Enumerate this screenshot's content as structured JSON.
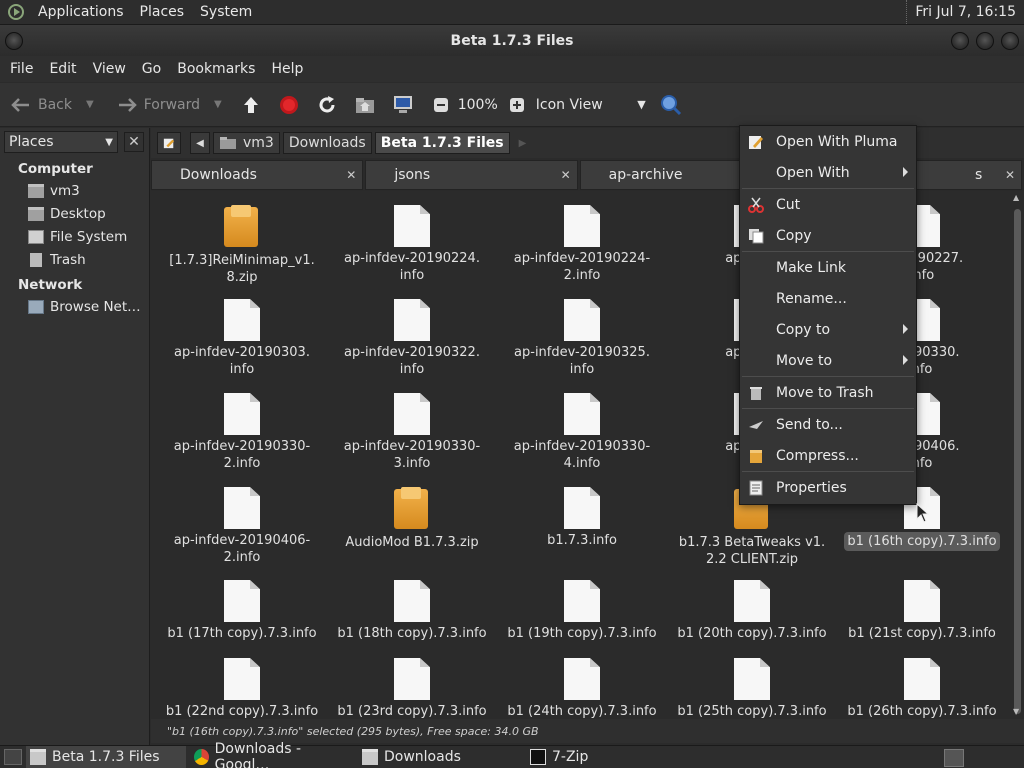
{
  "top_panel": {
    "menus": [
      "Applications",
      "Places",
      "System"
    ],
    "clock": "Fri Jul  7, 16:15"
  },
  "window": {
    "title": "Beta 1.7.3 Files"
  },
  "menubar": [
    "File",
    "Edit",
    "View",
    "Go",
    "Bookmarks",
    "Help"
  ],
  "toolbar": {
    "back": "Back",
    "forward": "Forward",
    "zoom": "100%",
    "view_mode": "Icon View"
  },
  "sidebar": {
    "selector": "Places",
    "groups": [
      {
        "label": "Computer",
        "items": [
          "vm3",
          "Desktop",
          "File System",
          "Trash"
        ]
      },
      {
        "label": "Network",
        "items": [
          "Browse Net…"
        ]
      }
    ]
  },
  "pathbar": {
    "crumbs": [
      "vm3",
      "Downloads",
      "Beta 1.7.3 Files"
    ]
  },
  "tabs": [
    "Downloads",
    "jsons",
    "ap-archive",
    "s"
  ],
  "files": [
    {
      "name": "[1.7.3]ReiMinimap_v1.\n8.zip",
      "type": "zip"
    },
    {
      "name": "ap-infdev-20190224.\ninfo",
      "type": "doc"
    },
    {
      "name": "ap-infdev-20190224-\n2.info",
      "type": "doc"
    },
    {
      "name": "ap-infde",
      "type": "doc"
    },
    {
      "name": "v-20190227.\ninfo",
      "type": "doc"
    },
    {
      "name": "ap-infdev-20190303.\ninfo",
      "type": "doc"
    },
    {
      "name": "ap-infdev-20190322.\ninfo",
      "type": "doc"
    },
    {
      "name": "ap-infdev-20190325.\ninfo",
      "type": "doc"
    },
    {
      "name": "ap-infde",
      "type": "doc"
    },
    {
      "name": "-20190330.\nnfo",
      "type": "doc"
    },
    {
      "name": "ap-infdev-20190330-\n2.info",
      "type": "doc"
    },
    {
      "name": "ap-infdev-20190330-\n3.info",
      "type": "doc"
    },
    {
      "name": "ap-infdev-20190330-\n4.info",
      "type": "doc"
    },
    {
      "name": "ap-infde",
      "type": "doc"
    },
    {
      "name": "-20190406.\nnfo",
      "type": "doc"
    },
    {
      "name": "ap-infdev-20190406-\n2.info",
      "type": "doc"
    },
    {
      "name": "AudioMod B1.7.3.zip",
      "type": "zip"
    },
    {
      "name": "b1.7.3.info",
      "type": "doc"
    },
    {
      "name": "b1.7.3 BetaTweaks v1.\n2.2 CLIENT.zip",
      "type": "zip"
    },
    {
      "name": "b1 (16th copy).7.3.info",
      "type": "doc",
      "selected": true
    },
    {
      "name": "b1 (17th copy).7.3.info",
      "type": "doc"
    },
    {
      "name": "b1 (18th copy).7.3.info",
      "type": "doc"
    },
    {
      "name": "b1 (19th copy).7.3.info",
      "type": "doc"
    },
    {
      "name": "b1 (20th copy).7.3.info",
      "type": "doc"
    },
    {
      "name": "b1 (21st copy).7.3.info",
      "type": "doc"
    },
    {
      "name": "b1 (22nd copy).7.3.info",
      "type": "doc"
    },
    {
      "name": "b1 (23rd copy).7.3.info",
      "type": "doc"
    },
    {
      "name": "b1 (24th copy).7.3.info",
      "type": "doc"
    },
    {
      "name": "b1 (25th copy).7.3.info",
      "type": "doc"
    },
    {
      "name": "b1 (26th copy).7.3.info",
      "type": "doc"
    }
  ],
  "status": "\"b1 (16th copy).7.3.info\" selected (295 bytes), Free space: 34.0 GB",
  "context_menu": [
    {
      "label": "Open With Pluma",
      "icon": "pluma-icon"
    },
    {
      "label": "Open With",
      "submenu": true
    },
    {
      "sep": true
    },
    {
      "label": "Cut",
      "icon": "scissors-icon"
    },
    {
      "label": "Copy",
      "icon": "copy-icon"
    },
    {
      "sep": true
    },
    {
      "label": "Make Link"
    },
    {
      "label": "Rename..."
    },
    {
      "label": "Copy to",
      "submenu": true
    },
    {
      "label": "Move to",
      "submenu": true
    },
    {
      "sep": true
    },
    {
      "label": "Move to Trash",
      "icon": "trash-icon"
    },
    {
      "sep": true
    },
    {
      "label": "Send to...",
      "icon": "send-icon"
    },
    {
      "label": "Compress...",
      "icon": "archive-icon"
    },
    {
      "sep": true
    },
    {
      "label": "Properties",
      "icon": "properties-icon"
    }
  ],
  "taskbar": [
    {
      "label": "Beta 1.7.3 Files",
      "icon": "folder-icon",
      "active": true
    },
    {
      "label": "Downloads - Googl…",
      "icon": "chrome-icon"
    },
    {
      "label": "Downloads",
      "icon": "folder-icon"
    },
    {
      "label": "7-Zip",
      "icon": "7zip-icon"
    }
  ]
}
